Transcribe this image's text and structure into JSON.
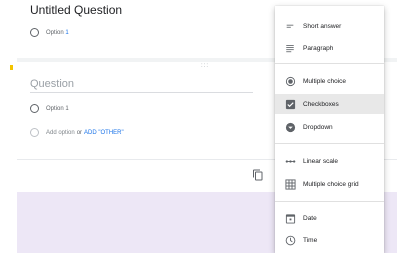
{
  "top_card": {
    "title": "Untitled Question",
    "option_label": "Option ",
    "option_number": "1"
  },
  "question_card": {
    "drag_handle": ":::",
    "question_placeholder": "Question",
    "option_label": "Option 1",
    "add_option": "Add option",
    "or": "or",
    "add_other": "ADD \"OTHER\""
  },
  "menu": {
    "items": [
      {
        "label": "Short answer",
        "icon": "short-answer-icon"
      },
      {
        "label": "Paragraph",
        "icon": "paragraph-icon"
      },
      {
        "label": "Multiple choice",
        "icon": "radio-checked-icon"
      },
      {
        "label": "Checkboxes",
        "icon": "checkbox-icon",
        "selected": true
      },
      {
        "label": "Dropdown",
        "icon": "dropdown-icon"
      },
      {
        "label": "Linear scale",
        "icon": "linear-scale-icon"
      },
      {
        "label": "Multiple choice grid",
        "icon": "grid-icon"
      },
      {
        "label": "Date",
        "icon": "calendar-icon"
      },
      {
        "label": "Time",
        "icon": "clock-icon"
      }
    ]
  },
  "colors": {
    "accent": "#1a73e8",
    "lavender_bg": "#ede7f6",
    "selected_bg": "#e8e8e8",
    "yellow_mark": "#f4c400"
  }
}
